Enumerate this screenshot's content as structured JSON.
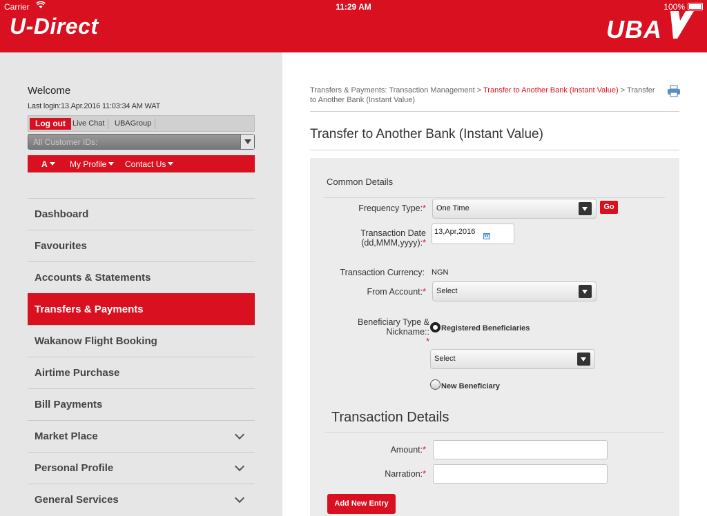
{
  "status_bar": {
    "carrier": "Carrier",
    "time": "11:29 AM",
    "battery": "100%"
  },
  "header": {
    "title": "U-Direct",
    "brand": "UBA"
  },
  "sidebar": {
    "welcome": "Welcome",
    "last_login": "Last login:13.Apr.2016 11:03:34 AM WAT",
    "quick_links": {
      "logout": "Log out",
      "live_chat": "Live Chat",
      "uba_group": "UBAGroup"
    },
    "customer_select": "All Customer IDs:",
    "menu": {
      "font_size": "A",
      "my_profile": "My Profile",
      "contact_us": "Contact Us"
    },
    "nav_items": [
      {
        "label": "Dashboard"
      },
      {
        "label": "Favourites"
      },
      {
        "label": "Accounts & Statements"
      },
      {
        "label": "Transfers & Payments",
        "active": true
      },
      {
        "label": "Wakanow Flight Booking"
      },
      {
        "label": "Airtime Purchase"
      },
      {
        "label": "Bill Payments"
      },
      {
        "label": "Market Place",
        "expandable": true
      },
      {
        "label": "Personal Profile",
        "expandable": true
      },
      {
        "label": "General Services",
        "expandable": true
      }
    ]
  },
  "main": {
    "breadcrumb": {
      "part1": "Transfers & Payments: Transaction Management > ",
      "part2": "Transfer to Another Bank (Instant Value)",
      "part3": " > Transfer to Another Bank (Instant Value)"
    },
    "page_title": "Transfer to Another Bank (Instant Value)",
    "common_details": {
      "heading": "Common Details",
      "frequency_label": "Frequency Type:",
      "frequency_value": "One Time",
      "go_label": "Go",
      "date_label_1": "Transaction Date",
      "date_label_2": "(dd,MMM,yyyy):",
      "date_value": "13,Apr,2016",
      "currency_label": "Transaction Currency:",
      "currency_value": "NGN",
      "from_account_label": "From Account:",
      "from_account_value": "Select",
      "beneficiary_label_1": "Beneficiary Type &",
      "beneficiary_label_2": "Nickname::",
      "registered_label": "Registered Beneficiaries",
      "beneficiary_select": "Select",
      "new_label": "New Beneficiary"
    },
    "transaction_details": {
      "heading": "Transaction Details",
      "amount_label": "Amount:",
      "amount_value": "",
      "narration_label": "Narration:",
      "narration_value": "",
      "add_button": "Add New Entry"
    }
  },
  "colors": {
    "brand_red": "#d9101f",
    "sidebar_bg": "#e6e6e6",
    "panel_bg": "#ececec"
  }
}
